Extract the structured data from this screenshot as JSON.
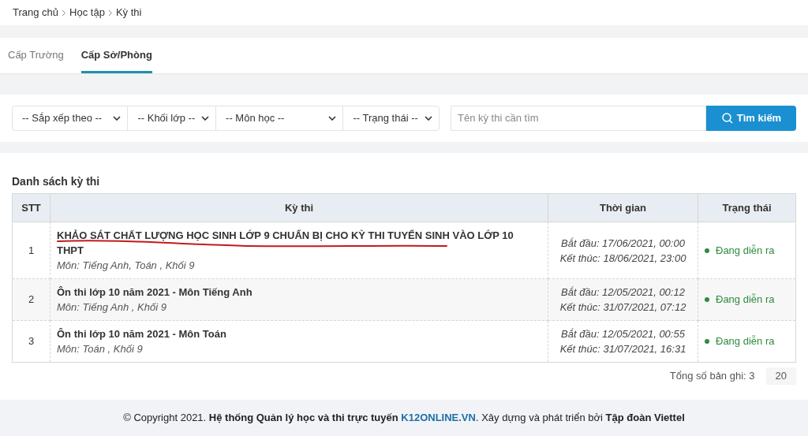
{
  "breadcrumb": [
    "Trang chủ",
    "Học tập",
    "Kỳ thi"
  ],
  "tabs": [
    {
      "label": "Cấp Trường",
      "selected": false
    },
    {
      "label": "Cấp Sở/Phòng",
      "selected": true
    }
  ],
  "filters": [
    {
      "label": "-- Sắp xếp theo --"
    },
    {
      "label": "-- Khối lớp --"
    },
    {
      "label": "-- Môn học --"
    },
    {
      "label": "-- Trạng thái --"
    }
  ],
  "search": {
    "placeholder": "Tên kỳ thi cần tìm",
    "button": "Tìm kiếm"
  },
  "list_title": "Danh sách kỳ thi",
  "table": {
    "columns": [
      "STT",
      "Kỳ thi",
      "Thời gian",
      "Trạng thái"
    ],
    "rows": [
      {
        "stt": "1",
        "title": "KHẢO SÁT CHẤT LƯỢNG HỌC SINH LỚP 9 CHUẨN BỊ CHO KỲ THI TUYỂN SINH VÀO LỚP 10 THPT",
        "subtitle": "Môn: Tiếng Anh, Toán , Khối 9",
        "start": "Bắt đầu: 17/06/2021, 00:00",
        "end": "Kết thúc: 18/06/2021, 23:00",
        "status": "Đang diễn ra",
        "color": "#2e8b3e",
        "underlined": true
      },
      {
        "stt": "2",
        "title": "Ôn thi lớp 10 năm 2021 - Môn Tiếng Anh",
        "subtitle": "Môn: Tiếng Anh , Khối 9",
        "start": "Bắt đầu: 12/05/2021, 00:12",
        "end": "Kết thúc: 31/07/2021, 07:12",
        "status": "Đang diễn ra",
        "color": "#2e8b3e",
        "underlined": false
      },
      {
        "stt": "3",
        "title": "Ôn thi lớp 10 năm 2021 - Môn Toán",
        "subtitle": "Môn: Toán , Khối 9",
        "start": "Bắt đầu: 12/05/2021, 00:55",
        "end": "Kết thúc: 31/07/2021, 16:31",
        "status": "Đang diễn ra",
        "color": "#2e8b3e",
        "underlined": false
      }
    ]
  },
  "total": "Tổng số bản ghi: 3",
  "page_size": "20",
  "footer": {
    "before": "© Copyright 2021. **Hệ thống Quản lý học và thi trực tuyến** ",
    "link": "K12ONLINE.VN",
    "after": ". Xây dựng và phát triển bởi **Tập đoàn Viettel**"
  }
}
